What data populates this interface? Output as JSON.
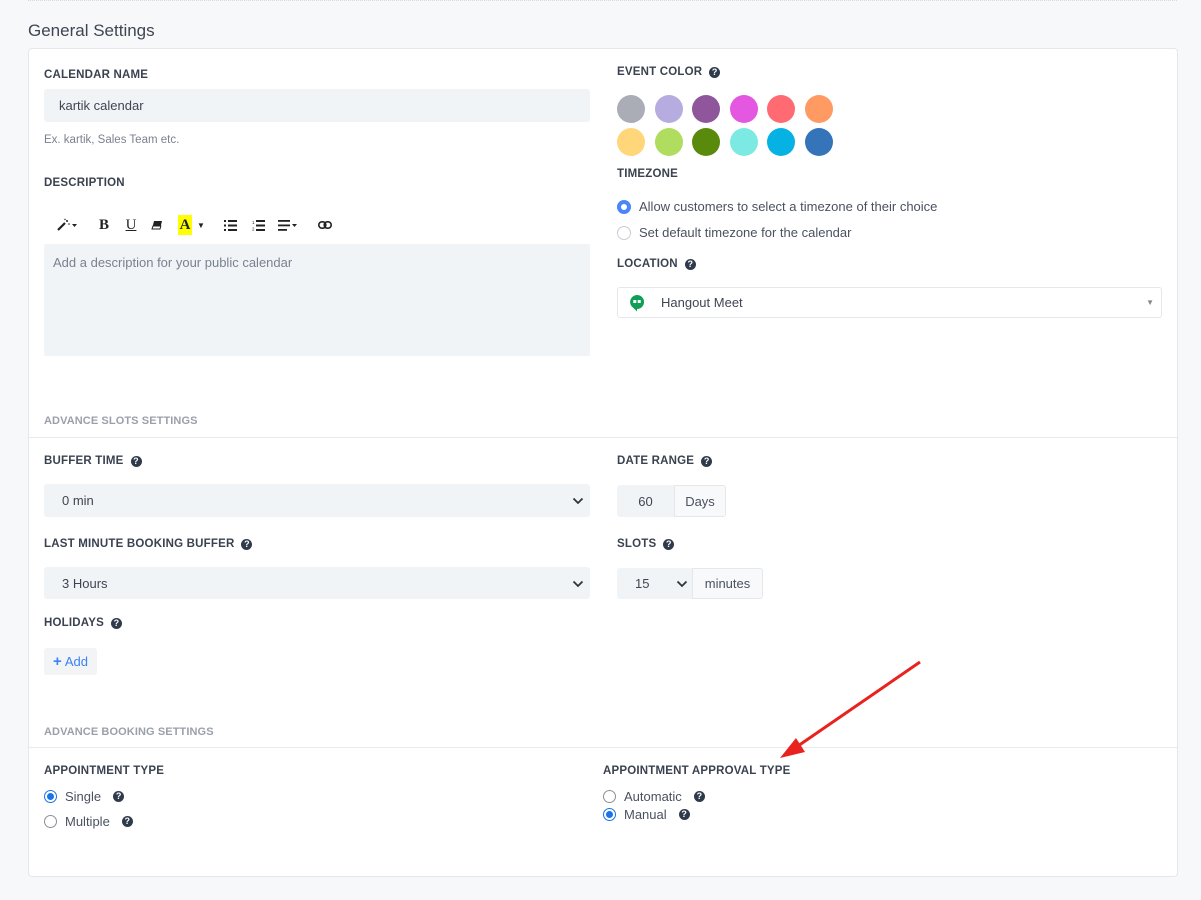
{
  "page": {
    "title": "General Settings"
  },
  "calendar_name": {
    "label": "CALENDAR NAME",
    "value": "kartik calendar",
    "hint": "Ex. kartik, Sales Team etc."
  },
  "description": {
    "label": "DESCRIPTION",
    "placeholder": "Add a description for your public calendar",
    "toolbar": [
      "magic-wand",
      "bold",
      "underline",
      "eraser",
      "text-highlight",
      "unordered-list",
      "ordered-list",
      "align",
      "link"
    ]
  },
  "event_color": {
    "label": "EVENT COLOR",
    "help": "?",
    "colors": [
      "#aaadb5",
      "#b6ace0",
      "#8f569b",
      "#e457e0",
      "#ff6a73",
      "#ff9a62",
      "#ffd67a",
      "#b0dc60",
      "#5a8a0c",
      "#7ce9e2",
      "#06b2e3",
      "#3574b8"
    ]
  },
  "timezone": {
    "label": "TIMEZONE",
    "options": [
      {
        "label": "Allow customers to select a timezone of their choice",
        "selected": true
      },
      {
        "label": "Set default timezone for the calendar",
        "selected": false
      }
    ]
  },
  "location": {
    "label": "LOCATION",
    "help": "?",
    "value": "Hangout Meet",
    "icon": "hangouts-icon"
  },
  "advance_slots": {
    "title": "ADVANCE SLOTS SETTINGS",
    "buffer_time": {
      "label": "BUFFER TIME",
      "help": "?",
      "value": "0 min"
    },
    "last_minute": {
      "label": "LAST MINUTE BOOKING BUFFER",
      "help": "?",
      "value": "3 Hours"
    },
    "holidays": {
      "label": "HOLIDAYS",
      "help": "?",
      "add_label": "Add",
      "add_icon": "+"
    },
    "date_range": {
      "label": "DATE RANGE",
      "help": "?",
      "value": "60",
      "unit": "Days"
    },
    "slots": {
      "label": "SLOTS",
      "help": "?",
      "value": "15",
      "unit": "minutes"
    }
  },
  "advance_booking": {
    "title": "ADVANCE BOOKING SETTINGS",
    "appointment_type": {
      "label": "APPOINTMENT TYPE",
      "options": [
        {
          "label": "Single",
          "selected": true,
          "help": "?"
        },
        {
          "label": "Multiple",
          "selected": false,
          "help": "?"
        }
      ]
    },
    "approval_type": {
      "label": "APPOINTMENT APPROVAL TYPE",
      "options": [
        {
          "label": "Automatic",
          "selected": false,
          "help": "?"
        },
        {
          "label": "Manual",
          "selected": true,
          "help": "?"
        }
      ]
    }
  },
  "annotation": {
    "type": "arrow",
    "color": "#e8231f"
  },
  "chevron": "⌄"
}
